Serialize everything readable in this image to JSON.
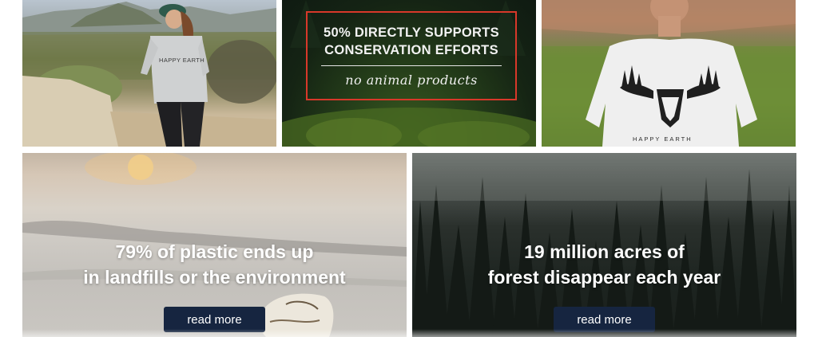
{
  "tiles": {
    "forest_message": {
      "line1": "50% DIRECTLY SUPPORTS",
      "line2": "CONSERVATION EFFORTS",
      "script_text": "no animal products",
      "frame_color": "#d8382a"
    },
    "hiker": {
      "shirt_text": "HAPPY EARTH"
    },
    "back_shirt": {
      "shirt_text": "HAPPY EARTH"
    },
    "plastic": {
      "headline_line1": "79% of plastic ends up",
      "headline_line2": "in landfills or the environment",
      "button_label": "read more"
    },
    "dark_forest": {
      "headline_line1": "19 million acres of",
      "headline_line2": "forest disappear each year",
      "button_label": "read more"
    }
  },
  "colors": {
    "button_bg": "#162540",
    "button_text": "#ffffff",
    "headline_text": "#ffffff",
    "page_bg": "#ffffff"
  }
}
